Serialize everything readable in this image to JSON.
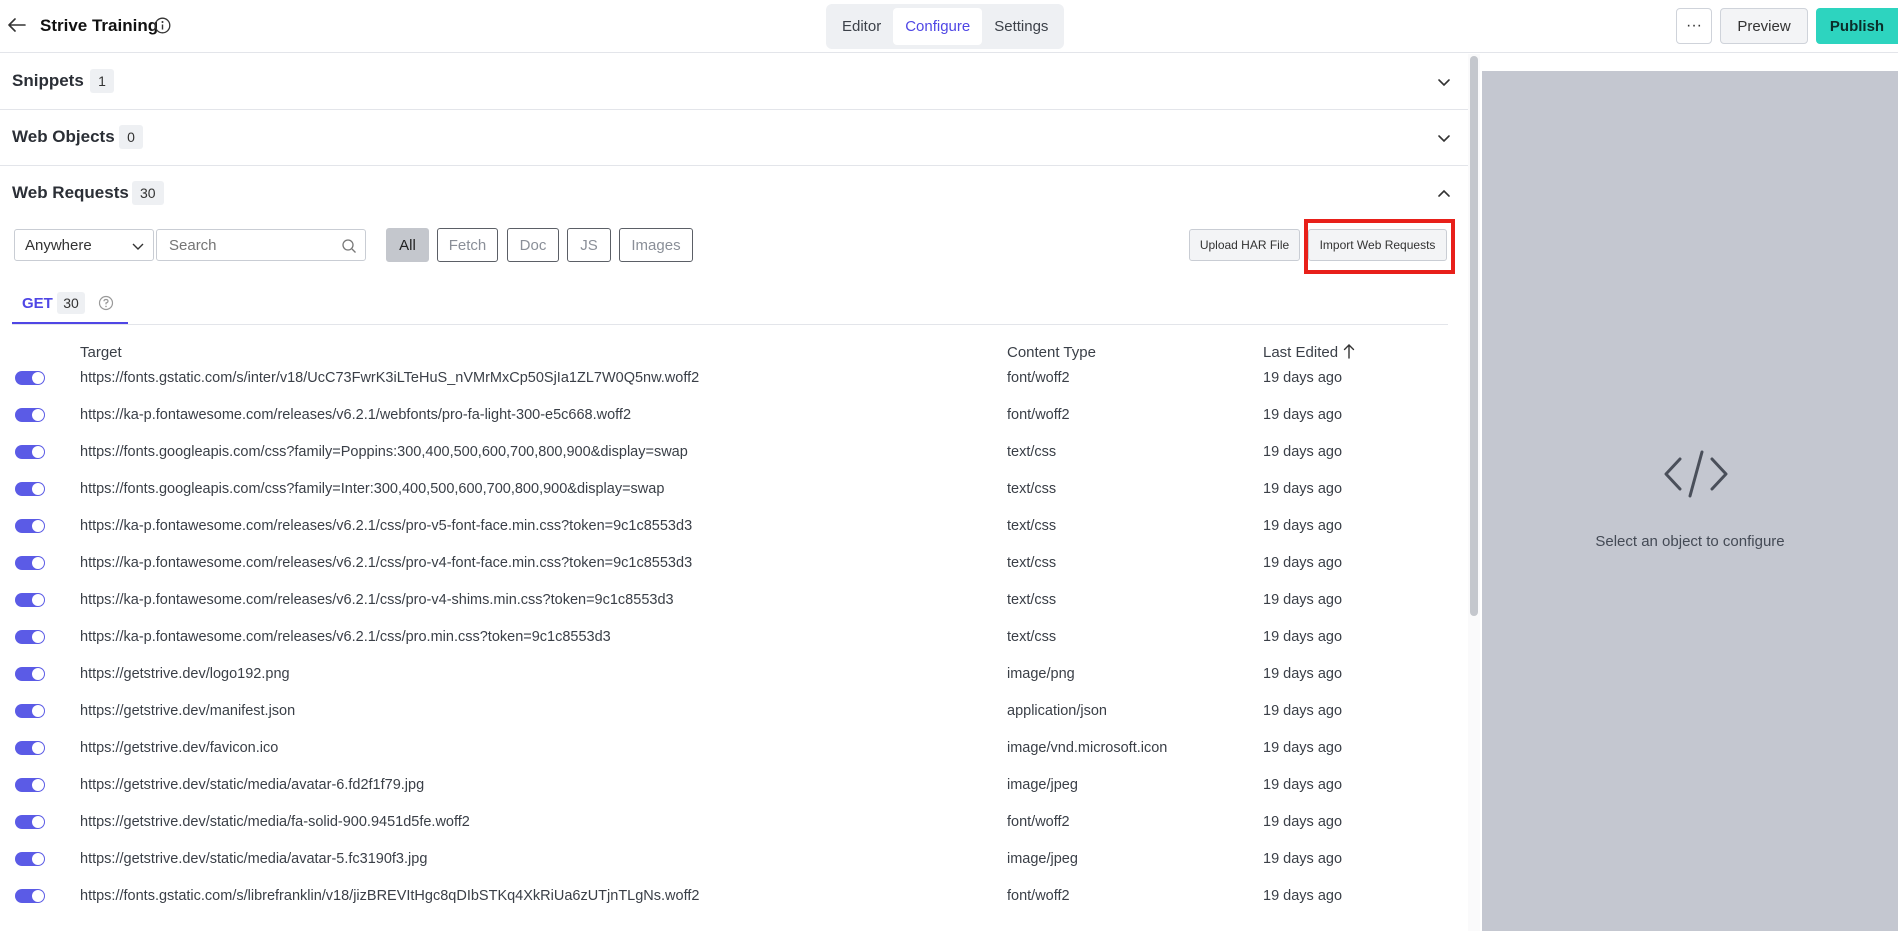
{
  "header": {
    "title": "Strive Training",
    "tabs": [
      {
        "label": "Editor"
      },
      {
        "label": "Configure"
      },
      {
        "label": "Settings"
      }
    ],
    "more_label": "···",
    "preview_label": "Preview",
    "publish_label": "Publish"
  },
  "sections": {
    "snippets": {
      "title": "Snippets",
      "count": "1"
    },
    "web_objects": {
      "title": "Web Objects",
      "count": "0"
    },
    "web_requests": {
      "title": "Web Requests",
      "count": "30"
    }
  },
  "filters": {
    "scope": "Anywhere",
    "search_placeholder": "Search",
    "chips": [
      {
        "label": "All"
      },
      {
        "label": "Fetch"
      },
      {
        "label": "Doc"
      },
      {
        "label": "JS"
      },
      {
        "label": "Images"
      }
    ],
    "upload_label": "Upload HAR File",
    "import_label": "Import Web Requests"
  },
  "method_tab": {
    "label": "GET",
    "count": "30"
  },
  "table": {
    "headers": {
      "target": "Target",
      "content_type": "Content Type",
      "last_edited": "Last Edited"
    },
    "rows": [
      {
        "target": "https://fonts.gstatic.com/s/inter/v18/UcC73FwrK3iLTeHuS_nVMrMxCp50SjIa1ZL7W0Q5nw.woff2",
        "type": "font/woff2",
        "edited": "19 days ago"
      },
      {
        "target": "https://ka-p.fontawesome.com/releases/v6.2.1/webfonts/pro-fa-light-300-e5c668.woff2",
        "type": "font/woff2",
        "edited": "19 days ago"
      },
      {
        "target": "https://fonts.googleapis.com/css?family=Poppins:300,400,500,600,700,800,900&display=swap",
        "type": "text/css",
        "edited": "19 days ago"
      },
      {
        "target": "https://fonts.googleapis.com/css?family=Inter:300,400,500,600,700,800,900&display=swap",
        "type": "text/css",
        "edited": "19 days ago"
      },
      {
        "target": "https://ka-p.fontawesome.com/releases/v6.2.1/css/pro-v5-font-face.min.css?token=9c1c8553d3",
        "type": "text/css",
        "edited": "19 days ago"
      },
      {
        "target": "https://ka-p.fontawesome.com/releases/v6.2.1/css/pro-v4-font-face.min.css?token=9c1c8553d3",
        "type": "text/css",
        "edited": "19 days ago"
      },
      {
        "target": "https://ka-p.fontawesome.com/releases/v6.2.1/css/pro-v4-shims.min.css?token=9c1c8553d3",
        "type": "text/css",
        "edited": "19 days ago"
      },
      {
        "target": "https://ka-p.fontawesome.com/releases/v6.2.1/css/pro.min.css?token=9c1c8553d3",
        "type": "text/css",
        "edited": "19 days ago"
      },
      {
        "target": "https://getstrive.dev/logo192.png",
        "type": "image/png",
        "edited": "19 days ago"
      },
      {
        "target": "https://getstrive.dev/manifest.json",
        "type": "application/json",
        "edited": "19 days ago"
      },
      {
        "target": "https://getstrive.dev/favicon.ico",
        "type": "image/vnd.microsoft.icon",
        "edited": "19 days ago"
      },
      {
        "target": "https://getstrive.dev/static/media/avatar-6.fd2f1f79.jpg",
        "type": "image/jpeg",
        "edited": "19 days ago"
      },
      {
        "target": "https://getstrive.dev/static/media/fa-solid-900.9451d5fe.woff2",
        "type": "font/woff2",
        "edited": "19 days ago"
      },
      {
        "target": "https://getstrive.dev/static/media/avatar-5.fc3190f3.jpg",
        "type": "image/jpeg",
        "edited": "19 days ago"
      },
      {
        "target": "https://fonts.gstatic.com/s/librefranklin/v18/jizBREVItHgc8qDIbSTKq4XkRiUa6zUTjnTLgNs.woff2",
        "type": "font/woff2",
        "edited": "19 days ago"
      }
    ]
  },
  "right_panel": {
    "empty_text": "Select an object to configure"
  },
  "colors": {
    "accent": "#4f46e5",
    "publish": "#2dd4bf",
    "highlight": "#e8201a",
    "panel": "#c4c7d0"
  }
}
